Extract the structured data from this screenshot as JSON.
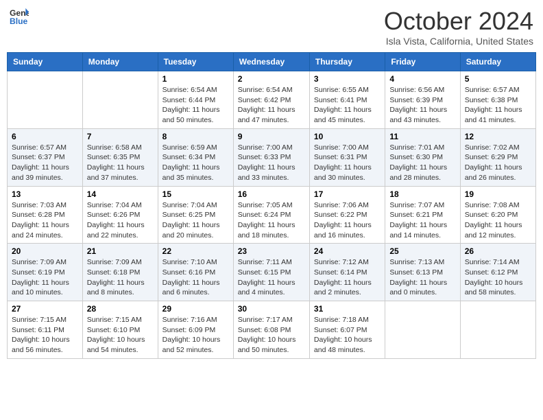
{
  "header": {
    "logo_line1": "General",
    "logo_line2": "Blue",
    "month_title": "October 2024",
    "location": "Isla Vista, California, United States"
  },
  "days_of_week": [
    "Sunday",
    "Monday",
    "Tuesday",
    "Wednesday",
    "Thursday",
    "Friday",
    "Saturday"
  ],
  "weeks": [
    [
      {
        "day": "",
        "info": ""
      },
      {
        "day": "",
        "info": ""
      },
      {
        "day": "1",
        "info": "Sunrise: 6:54 AM\nSunset: 6:44 PM\nDaylight: 11 hours and 50 minutes."
      },
      {
        "day": "2",
        "info": "Sunrise: 6:54 AM\nSunset: 6:42 PM\nDaylight: 11 hours and 47 minutes."
      },
      {
        "day": "3",
        "info": "Sunrise: 6:55 AM\nSunset: 6:41 PM\nDaylight: 11 hours and 45 minutes."
      },
      {
        "day": "4",
        "info": "Sunrise: 6:56 AM\nSunset: 6:39 PM\nDaylight: 11 hours and 43 minutes."
      },
      {
        "day": "5",
        "info": "Sunrise: 6:57 AM\nSunset: 6:38 PM\nDaylight: 11 hours and 41 minutes."
      }
    ],
    [
      {
        "day": "6",
        "info": "Sunrise: 6:57 AM\nSunset: 6:37 PM\nDaylight: 11 hours and 39 minutes."
      },
      {
        "day": "7",
        "info": "Sunrise: 6:58 AM\nSunset: 6:35 PM\nDaylight: 11 hours and 37 minutes."
      },
      {
        "day": "8",
        "info": "Sunrise: 6:59 AM\nSunset: 6:34 PM\nDaylight: 11 hours and 35 minutes."
      },
      {
        "day": "9",
        "info": "Sunrise: 7:00 AM\nSunset: 6:33 PM\nDaylight: 11 hours and 33 minutes."
      },
      {
        "day": "10",
        "info": "Sunrise: 7:00 AM\nSunset: 6:31 PM\nDaylight: 11 hours and 30 minutes."
      },
      {
        "day": "11",
        "info": "Sunrise: 7:01 AM\nSunset: 6:30 PM\nDaylight: 11 hours and 28 minutes."
      },
      {
        "day": "12",
        "info": "Sunrise: 7:02 AM\nSunset: 6:29 PM\nDaylight: 11 hours and 26 minutes."
      }
    ],
    [
      {
        "day": "13",
        "info": "Sunrise: 7:03 AM\nSunset: 6:28 PM\nDaylight: 11 hours and 24 minutes."
      },
      {
        "day": "14",
        "info": "Sunrise: 7:04 AM\nSunset: 6:26 PM\nDaylight: 11 hours and 22 minutes."
      },
      {
        "day": "15",
        "info": "Sunrise: 7:04 AM\nSunset: 6:25 PM\nDaylight: 11 hours and 20 minutes."
      },
      {
        "day": "16",
        "info": "Sunrise: 7:05 AM\nSunset: 6:24 PM\nDaylight: 11 hours and 18 minutes."
      },
      {
        "day": "17",
        "info": "Sunrise: 7:06 AM\nSunset: 6:22 PM\nDaylight: 11 hours and 16 minutes."
      },
      {
        "day": "18",
        "info": "Sunrise: 7:07 AM\nSunset: 6:21 PM\nDaylight: 11 hours and 14 minutes."
      },
      {
        "day": "19",
        "info": "Sunrise: 7:08 AM\nSunset: 6:20 PM\nDaylight: 11 hours and 12 minutes."
      }
    ],
    [
      {
        "day": "20",
        "info": "Sunrise: 7:09 AM\nSunset: 6:19 PM\nDaylight: 11 hours and 10 minutes."
      },
      {
        "day": "21",
        "info": "Sunrise: 7:09 AM\nSunset: 6:18 PM\nDaylight: 11 hours and 8 minutes."
      },
      {
        "day": "22",
        "info": "Sunrise: 7:10 AM\nSunset: 6:16 PM\nDaylight: 11 hours and 6 minutes."
      },
      {
        "day": "23",
        "info": "Sunrise: 7:11 AM\nSunset: 6:15 PM\nDaylight: 11 hours and 4 minutes."
      },
      {
        "day": "24",
        "info": "Sunrise: 7:12 AM\nSunset: 6:14 PM\nDaylight: 11 hours and 2 minutes."
      },
      {
        "day": "25",
        "info": "Sunrise: 7:13 AM\nSunset: 6:13 PM\nDaylight: 11 hours and 0 minutes."
      },
      {
        "day": "26",
        "info": "Sunrise: 7:14 AM\nSunset: 6:12 PM\nDaylight: 10 hours and 58 minutes."
      }
    ],
    [
      {
        "day": "27",
        "info": "Sunrise: 7:15 AM\nSunset: 6:11 PM\nDaylight: 10 hours and 56 minutes."
      },
      {
        "day": "28",
        "info": "Sunrise: 7:15 AM\nSunset: 6:10 PM\nDaylight: 10 hours and 54 minutes."
      },
      {
        "day": "29",
        "info": "Sunrise: 7:16 AM\nSunset: 6:09 PM\nDaylight: 10 hours and 52 minutes."
      },
      {
        "day": "30",
        "info": "Sunrise: 7:17 AM\nSunset: 6:08 PM\nDaylight: 10 hours and 50 minutes."
      },
      {
        "day": "31",
        "info": "Sunrise: 7:18 AM\nSunset: 6:07 PM\nDaylight: 10 hours and 48 minutes."
      },
      {
        "day": "",
        "info": ""
      },
      {
        "day": "",
        "info": ""
      }
    ]
  ]
}
